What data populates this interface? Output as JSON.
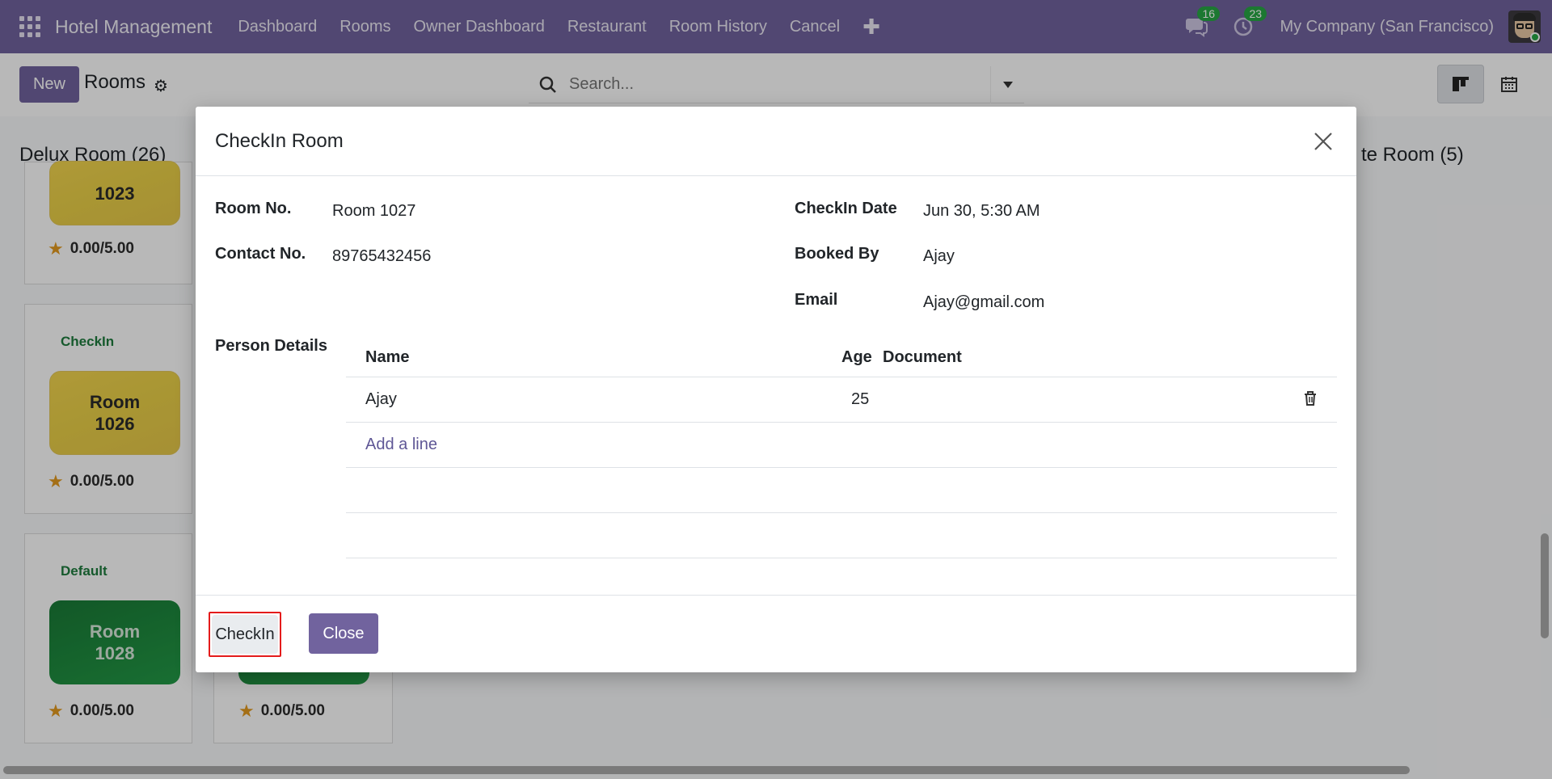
{
  "navbar": {
    "app_name": "Hotel Management",
    "menu": [
      "Dashboard",
      "Rooms",
      "Owner Dashboard",
      "Restaurant",
      "Room History",
      "Cancel"
    ],
    "messages_count": "16",
    "activities_count": "23",
    "company": "My Company (San Francisco)",
    "color": "#71639e"
  },
  "control": {
    "new_label": "New",
    "breadcrumb": "Rooms",
    "search_placeholder": "Search..."
  },
  "kanban": {
    "col1_title": "Delux Room (26)",
    "col_right_title": "te Room (5)",
    "cards": [
      {
        "room": "1023",
        "rating": "0.00/5.00"
      },
      {
        "state": "CheckIn",
        "room_line1": "Room",
        "room_line2": "1026",
        "rating": "0.00/5.00"
      },
      {
        "state": "Default",
        "room_line1": "Room",
        "room_line2": "1028",
        "rating": "0.00/5.00"
      },
      {
        "rating": "0.00/5.00"
      }
    ]
  },
  "modal": {
    "title": "CheckIn Room",
    "fields": {
      "room_no_label": "Room No.",
      "room_no_value": "Room 1027",
      "contact_label": "Contact No.",
      "contact_value": "89765432456",
      "checkin_date_label": "CheckIn Date",
      "checkin_date_value": "Jun 30, 5:30 AM",
      "booked_by_label": "Booked By",
      "booked_by_value": "Ajay",
      "email_label": "Email",
      "email_value": "Ajay@gmail.com",
      "person_details_label": "Person Details"
    },
    "table": {
      "headers": {
        "name": "Name",
        "age": "Age",
        "document": "Document"
      },
      "rows": [
        {
          "name": "Ajay",
          "age": "25",
          "document": ""
        }
      ],
      "add_line": "Add a line"
    },
    "footer": {
      "checkin_label": "CheckIn",
      "close_label": "Close"
    }
  }
}
